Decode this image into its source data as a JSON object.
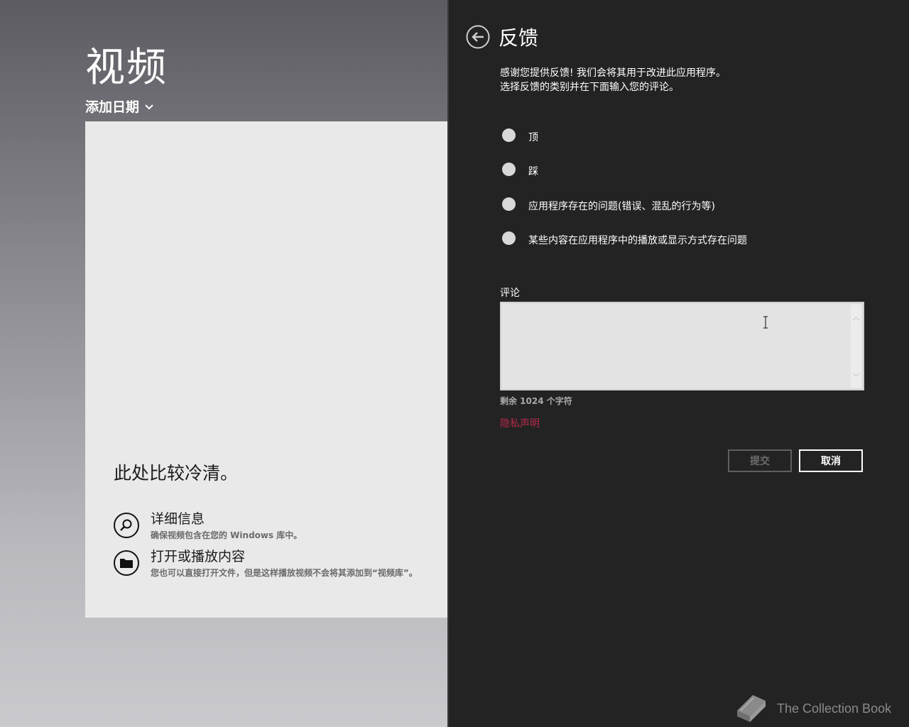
{
  "app": {
    "title": "视频",
    "sort_label": "添加日期",
    "empty_title": "此处比较冷清。",
    "hints": [
      {
        "title": "详细信息",
        "subtitle": "确保视频包含在您的 Windows 库中。",
        "icon": "search-icon"
      },
      {
        "title": "打开或播放内容",
        "subtitle": "您也可以直接打开文件，但是这样播放视频不会将其添加到“视频库”。",
        "icon": "folder-icon"
      }
    ]
  },
  "feedback": {
    "title": "反馈",
    "intro_line1": "感谢您提供反馈! 我们会将其用于改进此应用程序。",
    "intro_line2": "选择反馈的类别并在下面输入您的评论。",
    "options": [
      "顶",
      "踩",
      "应用程序存在的问题(错误、混乱的行为等)",
      "某些内容在应用程序中的播放或显示方式存在问题"
    ],
    "comment_label": "评论",
    "comment_value": "",
    "chars_remaining": "剩余 1024 个字符",
    "privacy_link": "隐私声明",
    "submit_label": "提交",
    "cancel_label": "取消"
  },
  "watermark": {
    "text": "The Collection Book",
    "icon": "book-icon"
  },
  "colors": {
    "flyout_bg": "#232323",
    "privacy_link": "#b5294a",
    "content_panel": "#e9e9e9"
  }
}
